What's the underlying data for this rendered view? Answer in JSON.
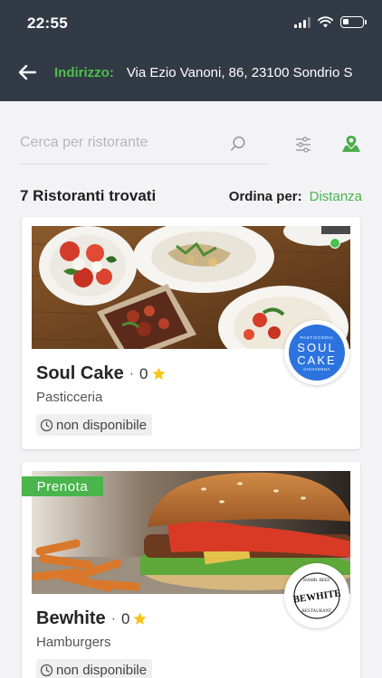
{
  "status": {
    "time": "22:55"
  },
  "header": {
    "address_label": "Indirizzo:",
    "address_value": "Via Ezio Vanoni, 86, 23100 Sondrio S"
  },
  "search": {
    "placeholder": "Cerca per ristorante",
    "value": ""
  },
  "results": {
    "count_label": "7 Ristoranti trovati",
    "sort_label": "Ordina per:",
    "sort_value": "Distanza"
  },
  "restaurants": [
    {
      "name": "Soul Cake",
      "separator": "·",
      "rating": "0",
      "category": "Pasticceria",
      "availability": "non disponibile",
      "logo_top": "PASTICCERIA",
      "logo_line1": "SOUL",
      "logo_line2": "CAKE",
      "logo_bottom": "CHIAVENNA",
      "online": true
    },
    {
      "name": "Bewhite",
      "separator": "·",
      "rating": "0",
      "category": "Hamburgers",
      "availability": "non disponibile",
      "tag": "Prenota",
      "logo_top": "HAMB. BEEF",
      "logo_main": "BEWHITE",
      "logo_bottom": "RESTAURANT"
    }
  ],
  "icons": {
    "back": "arrow-left-icon",
    "search": "search-icon",
    "filter": "sliders-icon",
    "map": "map-pin-icon",
    "rating": "star-icon",
    "availability": "clock-icon"
  },
  "colors": {
    "header_bg": "#323a45",
    "accent_green": "#46b54b",
    "star": "#f5c518",
    "soul_cake_blue": "#2c73de"
  }
}
